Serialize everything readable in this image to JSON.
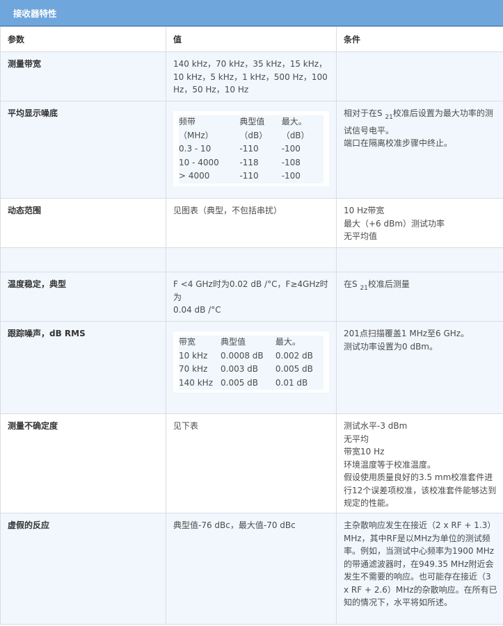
{
  "title": "接收器特性",
  "headers": [
    "参数",
    "值",
    "条件"
  ],
  "rows": {
    "r1": {
      "param": "测量带宽",
      "value": "140 kHz，70 kHz，35 kHz，15 kHz，10 kHz，5 kHz，1 kHz，500 Hz，100 Hz，50 Hz，10 Hz",
      "cond": ""
    },
    "r2": {
      "param": "平均显示噪底",
      "inner": {
        "h1a": "频带",
        "h1b": "（MHz）",
        "h2a": "典型值",
        "h2b": "（dB）",
        "h3a": "最大。",
        "h3b": "（dB）",
        "rows": [
          [
            "0.3 - 10",
            "-110",
            "-100"
          ],
          [
            "10 - 4000",
            "-118",
            "-108"
          ],
          [
            "> 4000",
            "-110",
            "-100"
          ]
        ]
      },
      "cond_a": "相对于在S ",
      "cond_sub": "21",
      "cond_b": "校准后设置为最大功率的测试信号电平。",
      "cond_c": "端口在隔离校准步骤中终止。"
    },
    "r3": {
      "param": "动态范围",
      "value": "见图表（典型，不包括串扰）",
      "cond": [
        "10 Hz带宽",
        "最大（+6 dBm）测试功率",
        "无平均值"
      ]
    },
    "r5": {
      "param": "温度稳定，典型",
      "value_a": "F <4 GHz时为0.02 dB /°C，F≥4GHz时为",
      "value_b": "0.04 dB /°C",
      "cond_a": "在S ",
      "cond_sub": "21",
      "cond_b": "校准后测量"
    },
    "r6": {
      "param": "跟踪噪声，dB RMS",
      "inner": {
        "headers": [
          "带宽",
          "典型值",
          "最大。"
        ],
        "rows": [
          [
            "10 kHz",
            "0.0008 dB",
            "0.002 dB"
          ],
          [
            "70 kHz",
            "0.003 dB",
            "0.005 dB"
          ],
          [
            "140 kHz",
            "0.005 dB",
            "0.01 dB"
          ]
        ]
      },
      "cond": [
        "201点扫描覆盖1 MHz至6 GHz。",
        "测试功率设置为0 dBm。"
      ]
    },
    "r7": {
      "param": "测量不确定度",
      "value": "见下表",
      "cond": [
        "测试水平-3 dBm",
        "无平均",
        "带宽10 Hz",
        "环境温度等于校准温度。",
        "假设使用质量良好的3.5 mm校准套件进行12个误差项校准，该校准套件能够达到规定的性能。"
      ]
    },
    "r8": {
      "param": "虚假的反应",
      "value": "典型值-76 dBc，最大值-70 dBc",
      "cond": "主杂散响应发生在接近（2 x RF + 1.3）MHz，其中RF是以MHz为单位的测试频率。例如，当测试中心频率为1900 MHz的带通滤波器时，在949.35 MHz附近会发生不需要的响应。也可能存在接近（3 x RF + 2.6）MHz的杂散响应。在所有已知的情况下，水平将如所述。"
    }
  }
}
